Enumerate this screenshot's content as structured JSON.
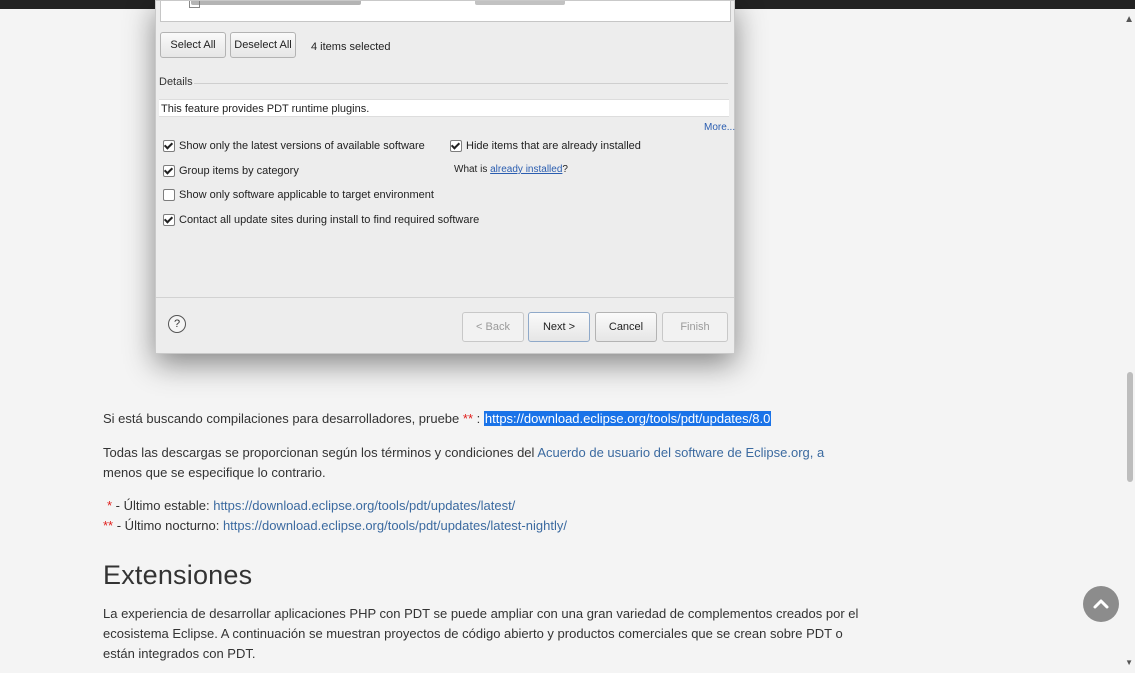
{
  "dialog": {
    "select_all": "Select All",
    "deselect_all": "Deselect All",
    "items_selected": "4 items selected",
    "details_label": "Details",
    "details_text": "This feature provides PDT runtime plugins.",
    "more_link": "More...",
    "options": {
      "latest_versions": {
        "label": "Show only the latest versions of available software",
        "checked": true
      },
      "group_by_category": {
        "label": "Group items by category",
        "checked": true
      },
      "target_env": {
        "label": "Show only software applicable to target environment",
        "checked": false
      },
      "contact_sites": {
        "label": "Contact all update sites during install to find required software",
        "checked": true
      },
      "hide_installed": {
        "label": "Hide items that are already installed",
        "checked": true
      }
    },
    "what_is": "What is ",
    "already_installed": "already installed",
    "question_mark": "?",
    "help": "?",
    "back": "< Back",
    "next": "Next >",
    "cancel": "Cancel",
    "finish": "Finish"
  },
  "page": {
    "dev_builds_text": "Si está buscando compilaciones para desarrolladores, pruebe ",
    "dev_builds_marker": "**",
    "dev_builds_colon": " : ",
    "dev_builds_url": "https://download.eclipse.org/tools/pdt/updates/8.0",
    "terms_text_1": "Todas las descargas se proporcionan según los términos y condiciones del ",
    "terms_link": "Acuerdo de usuario del software de Eclipse.org",
    "terms_text_2": ", a",
    "terms_text_3": "menos que se especifique lo contrario.",
    "stable_marker": "*",
    "stable_label": " - Último estable: ",
    "stable_url": "https://download.eclipse.org/tools/pdt/updates/latest/",
    "nightly_marker": "**",
    "nightly_label": " - Último nocturno: ",
    "nightly_url": "https://download.eclipse.org/tools/pdt/updates/latest-nightly/",
    "extensions_heading": "Extensiones",
    "extensions_line_1": "La experiencia de desarrollar aplicaciones PHP con PDT se puede ampliar con una gran variedad de complementos creados por el",
    "extensions_line_2": "ecosistema Eclipse. A continuación se muestran proyectos de código abierto y productos comerciales que se crean sobre PDT o",
    "extensions_line_3": "están integrados con PDT."
  },
  "colors": {
    "accent_link": "#3b6aa0",
    "highlight": "#1a73e8",
    "marker_red": "#e0201d",
    "fab": "#8c8c8c"
  },
  "icons": {
    "scroll_to_top": "chevron-up-icon",
    "help": "help-circle-icon"
  }
}
